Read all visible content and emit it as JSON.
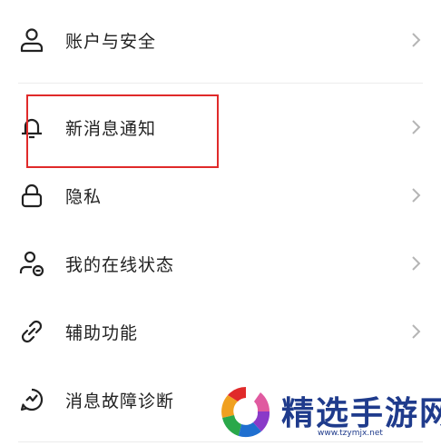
{
  "settings": {
    "items": [
      {
        "label": "账户与安全",
        "icon": "person-icon"
      },
      {
        "label": "新消息通知",
        "icon": "bell-icon"
      },
      {
        "label": "隐私",
        "icon": "lock-icon"
      },
      {
        "label": "我的在线状态",
        "icon": "person-status-icon"
      },
      {
        "label": "辅助功能",
        "icon": "link-icon"
      },
      {
        "label": "消息故障诊断",
        "icon": "diagnostic-icon"
      }
    ]
  },
  "watermark": {
    "brand": "精选手游网",
    "url": "www.tzymjx.net"
  },
  "colors": {
    "highlight": "#e02a2a",
    "text": "#222222",
    "chevron": "#b5b5b5",
    "brand": "#1f3b8c"
  }
}
